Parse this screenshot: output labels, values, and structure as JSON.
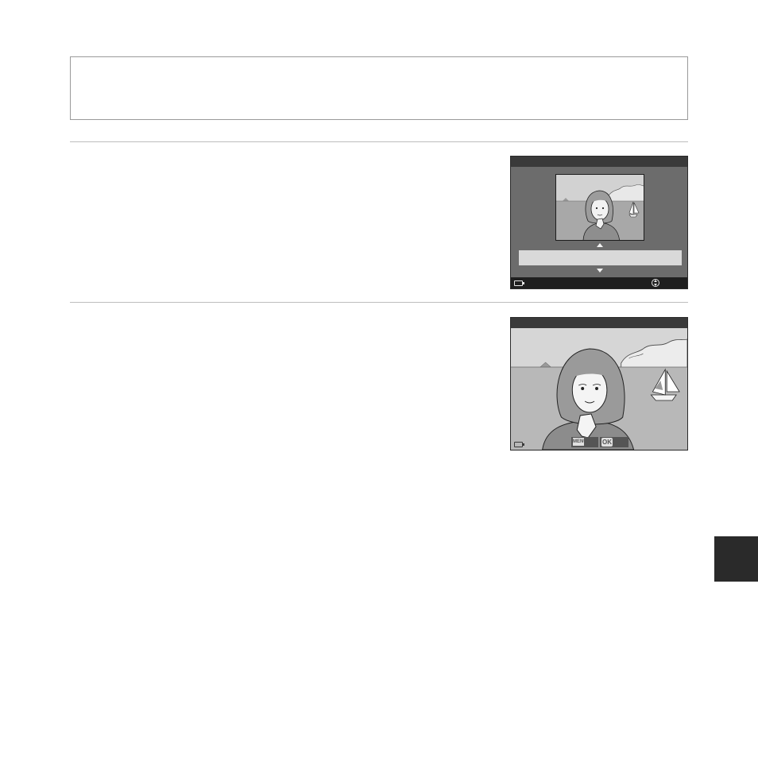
{
  "colors": {
    "screen_bg": "#6c6c6c",
    "title_bar": "#3a3a3a",
    "selection_bar": "#d9d9d9",
    "footer_bar": "#1f1f1f",
    "softkey_bg": "#555555",
    "side_tab": "#2a2a2a",
    "rule": "#bdbdbd",
    "box_border": "#9a9a9a"
  },
  "icons": {
    "battery": "battery-icon",
    "multi_selector": "multi-selector-icon",
    "arrow_up": "arrow-up-icon",
    "arrow_down": "arrow-down-icon",
    "menu_button": "menu-button-icon",
    "ok_button": "ok-button-icon"
  },
  "screen2": {
    "menu_icon_text": "MENU",
    "ok_icon_text": "OK"
  }
}
